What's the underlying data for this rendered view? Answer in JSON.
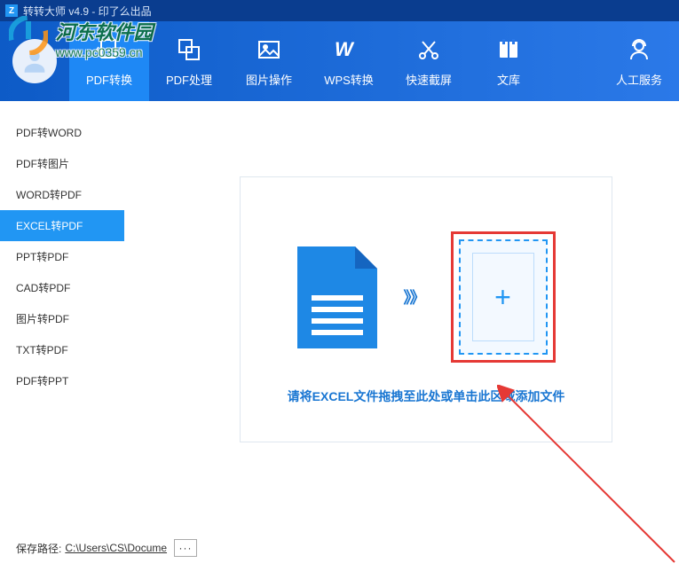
{
  "titlebar": {
    "app_sign": "Z",
    "title": "转转大师 v4.9 - 印了么出品"
  },
  "watermark": {
    "title": "河东软件园",
    "url": "www.pc0359.cn"
  },
  "nav": [
    {
      "label": "PDF转换",
      "active": true
    },
    {
      "label": "PDF处理",
      "active": false
    },
    {
      "label": "图片操作",
      "active": false
    },
    {
      "label": "WPS转换",
      "active": false
    },
    {
      "label": "快速截屏",
      "active": false
    },
    {
      "label": "文库",
      "active": false
    },
    {
      "label": "人工服务",
      "active": false
    }
  ],
  "sidebar": [
    {
      "label": "PDF转WORD",
      "active": false
    },
    {
      "label": "PDF转图片",
      "active": false
    },
    {
      "label": "WORD转PDF",
      "active": false
    },
    {
      "label": "EXCEL转PDF",
      "active": true
    },
    {
      "label": "PPT转PDF",
      "active": false
    },
    {
      "label": "CAD转PDF",
      "active": false
    },
    {
      "label": "图片转PDF",
      "active": false
    },
    {
      "label": "TXT转PDF",
      "active": false
    },
    {
      "label": "PDF转PPT",
      "active": false
    }
  ],
  "dropzone": {
    "hint": "请将EXCEL文件拖拽至此处或单击此区域添加文件",
    "plus": "+",
    "arrows": "》》"
  },
  "bottom": {
    "label": "保存路径:",
    "path": "C:\\Users\\CS\\Docume",
    "browse": "···"
  }
}
